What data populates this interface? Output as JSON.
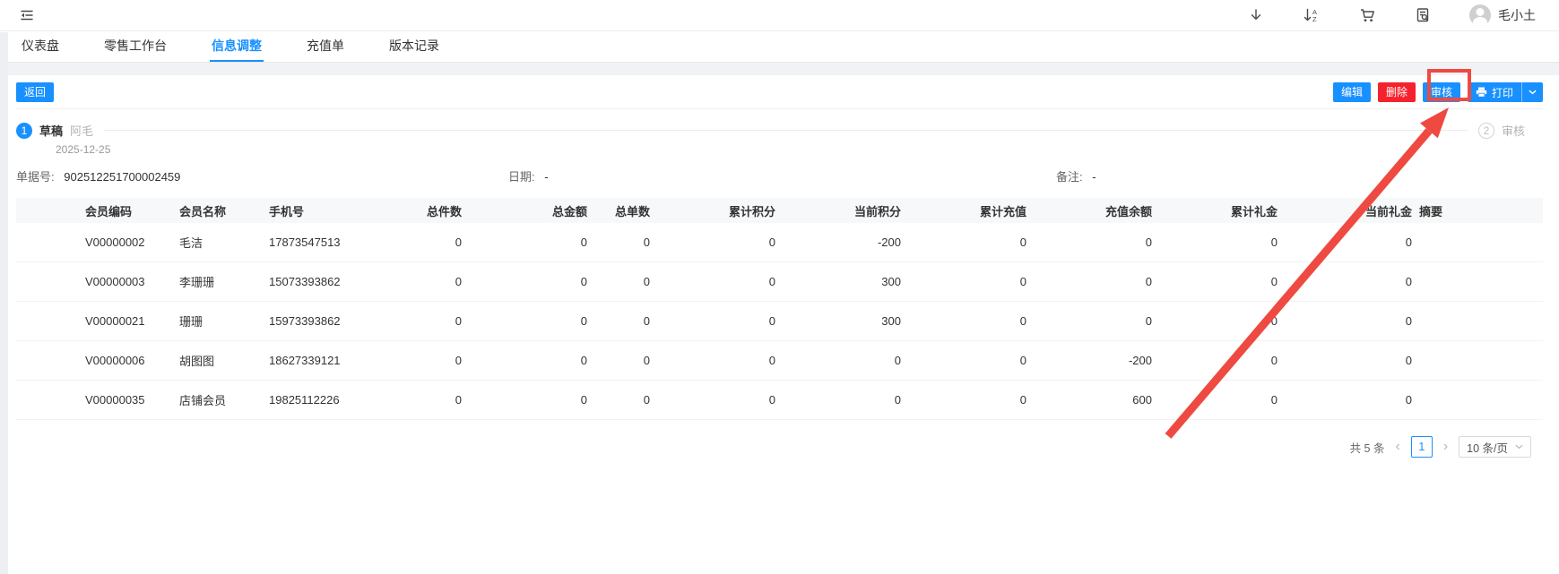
{
  "topbar": {
    "user_name": "毛小土",
    "icons": [
      "collapse-menu",
      "download",
      "sort-az",
      "shopping-cart",
      "document-search",
      "user-avatar"
    ]
  },
  "tabs": [
    {
      "label": "仪表盘",
      "active": false
    },
    {
      "label": "零售工作台",
      "active": false
    },
    {
      "label": "信息调整",
      "active": true
    },
    {
      "label": "充值单",
      "active": false
    },
    {
      "label": "版本记录",
      "active": false
    }
  ],
  "toolbar": {
    "back": "返回",
    "edit": "编辑",
    "delete": "删除",
    "audit": "审核",
    "print": "打印"
  },
  "steps": {
    "step1": {
      "number": "1",
      "title": "草稿",
      "operator": "阿毛",
      "date": "2025-12-25"
    },
    "step2": {
      "number": "2",
      "title": "审核"
    }
  },
  "document": {
    "order_label": "单据号:",
    "order_no": "902512251700002459",
    "date_label": "日期:",
    "date_value": "-",
    "remark_label": "备注:",
    "remark_value": "-"
  },
  "table": {
    "columns": [
      "会员编码",
      "会员名称",
      "手机号",
      "总件数",
      "总金额",
      "总单数",
      "累计积分",
      "当前积分",
      "累计充值",
      "充值余额",
      "累计礼金",
      "当前礼金",
      "摘要"
    ],
    "rows": [
      {
        "avatar_class": "av av-girl",
        "code": "V00000002",
        "name": "毛洁",
        "phone": "17873547513",
        "values": [
          "0",
          "0",
          "0",
          "0",
          "-200",
          "0",
          "0",
          "0",
          "0"
        ],
        "summary": ""
      },
      {
        "avatar_class": "av av-photo",
        "code": "V00000003",
        "name": "李珊珊",
        "phone": "15073393862",
        "values": [
          "0",
          "0",
          "0",
          "0",
          "300",
          "0",
          "0",
          "0",
          "0"
        ],
        "summary": ""
      },
      {
        "avatar_class": "av av-girl",
        "code": "V00000021",
        "name": "珊珊",
        "phone": "15973393862",
        "values": [
          "0",
          "0",
          "0",
          "0",
          "300",
          "0",
          "0",
          "0",
          "0"
        ],
        "summary": ""
      },
      {
        "avatar_class": "av av-boy",
        "code": "V00000006",
        "name": "胡图图",
        "phone": "18627339121",
        "values": [
          "0",
          "0",
          "0",
          "0",
          "0",
          "0",
          "-200",
          "0",
          "0"
        ],
        "summary": ""
      },
      {
        "avatar_class": "av av-boy",
        "code": "V00000035",
        "name": "店铺会员",
        "phone": "19825112226",
        "values": [
          "0",
          "0",
          "0",
          "0",
          "0",
          "0",
          "600",
          "0",
          "0"
        ],
        "summary": ""
      }
    ]
  },
  "pagination": {
    "total": "共 5 条",
    "page": "1",
    "page_size": "10 条/页"
  },
  "colors": {
    "primary": "#1890ff",
    "danger": "#f5222d",
    "annotation": "#ee4a41"
  }
}
